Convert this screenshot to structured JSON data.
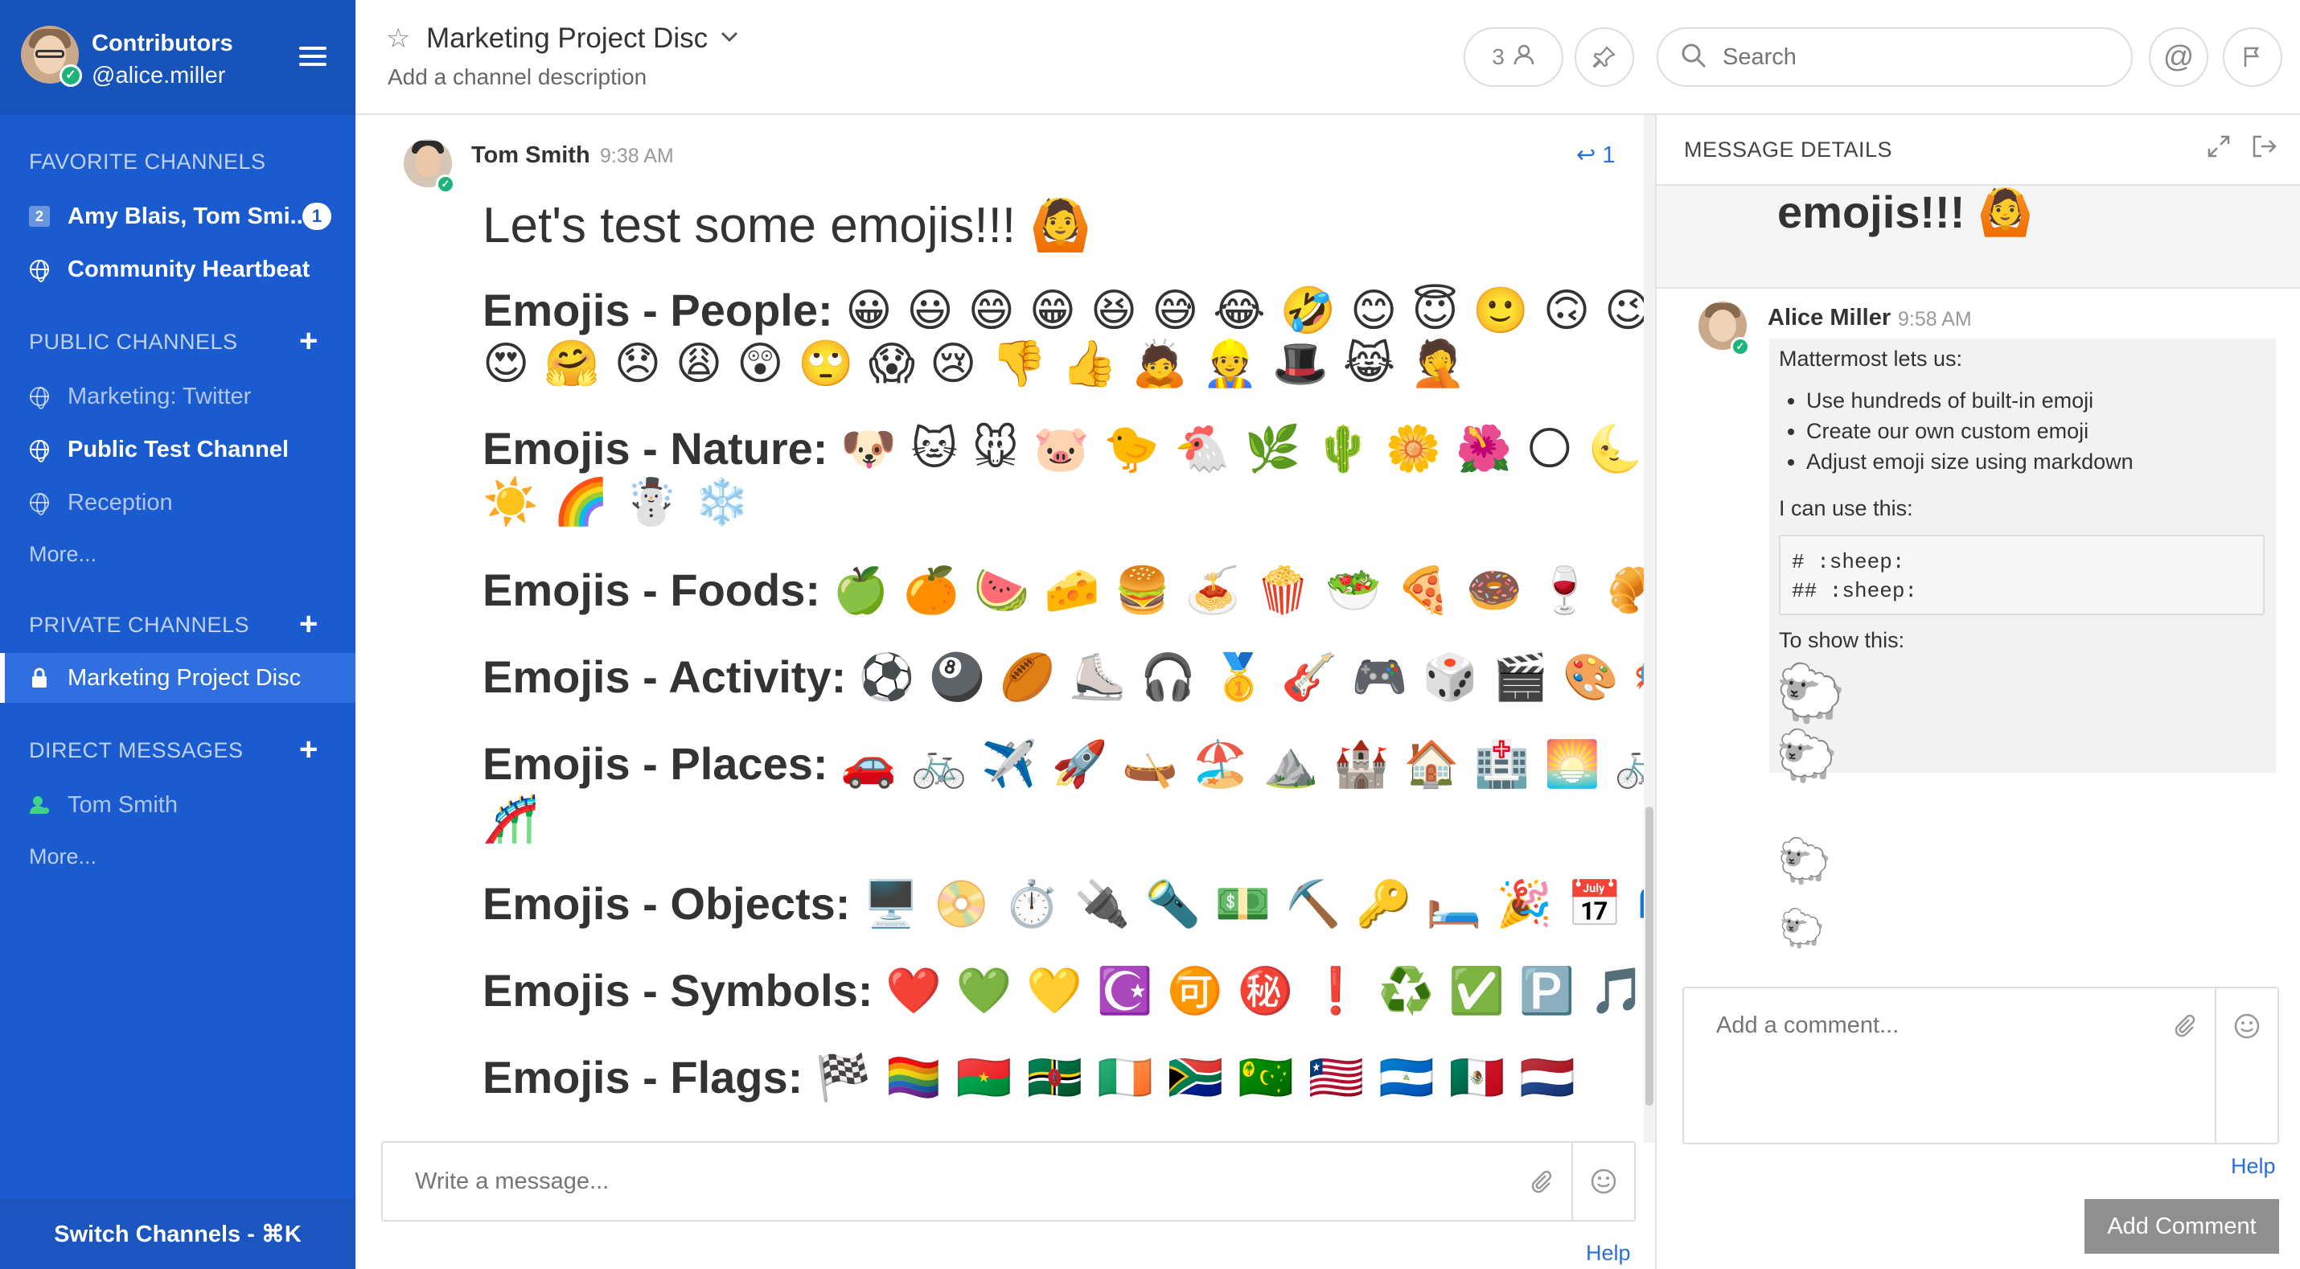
{
  "sidebar": {
    "team_name": "Contributors",
    "username": "@alice.miller",
    "sections": {
      "favorites": "FAVORITE CHANNELS",
      "public": "PUBLIC CHANNELS",
      "private": "PRIVATE CHANNELS",
      "direct": "DIRECT MESSAGES"
    },
    "favorites": [
      {
        "label": "Amy Blais, Tom Smi...",
        "icon": "2",
        "badge": "1"
      },
      {
        "label": "Community Heartbeat",
        "icon": "globe-icon"
      }
    ],
    "public": [
      {
        "label": "Marketing: Twitter",
        "icon": "globe-icon"
      },
      {
        "label": "Public Test Channel",
        "icon": "globe-icon"
      },
      {
        "label": "Reception",
        "icon": "globe-icon"
      }
    ],
    "public_more": "More...",
    "private": [
      {
        "label": "Marketing Project Disc",
        "icon": "lock-icon"
      }
    ],
    "direct": [
      {
        "label": "Tom Smith",
        "icon": "user-online-icon"
      }
    ],
    "direct_more": "More...",
    "switch_channels": "Switch Channels - ⌘K",
    "colors": {
      "background": "#1a5bcf",
      "header": "#1653bb",
      "active": "#2f6fe0"
    }
  },
  "header": {
    "channel_name": "Marketing Project Disc",
    "channel_description": "Add a channel description",
    "member_count": "3",
    "search_placeholder": "Search"
  },
  "post": {
    "author": "Tom Smith",
    "time": "9:38 AM",
    "reply_count": "1",
    "title": "Let's test some emojis!!!",
    "title_emoji": "🙆",
    "lines": [
      {
        "label": "Emojis - People:",
        "emojis": "😀 😃 😄 😁 😆 😅 😂 🤣 😊 😇 🙂 🙃 😉"
      },
      {
        "label": "",
        "emojis": "😍 🤗 😞 😩 😲 🙄 😱 😢 👎 👍 🙇 👷 🎩 😹 🤦"
      },
      {
        "label": "Emojis - Nature:",
        "emojis": "🐶 🐱 🐭 🐷 🐤 🐔 🌿 🌵 🌼 🌺 🌕 🌜 ⭐"
      },
      {
        "label": "",
        "emojis": "☀️ 🌈 ☃️ ❄️"
      },
      {
        "label": "Emojis - Foods:",
        "emojis": "🍏 🍊 🍉 🧀 🍔 🍝 🍿 🥗 🍕 🍩 🍷 🥐"
      },
      {
        "label": "Emojis - Activity:",
        "emojis": "⚽ 🎱 🏉 ⛸️ 🎧 🥇 🎸 🎮 🎲 🎬 🎨 🎭 🎪"
      },
      {
        "label": "Emojis - Places:",
        "emojis": "🚗 🚲 ✈️ 🚀 🛶 🏖️ ⛰️ 🏰 🏠 🏥 🌅 🚲 🗽"
      },
      {
        "label": "",
        "emojis": "🎢"
      },
      {
        "label": "Emojis - Objects:",
        "emojis": "🖥️ 📀 ⏱️ 🔌 🔦 💵 ⛏️ 🔑 🛏️ 🎉 📅 📫 📒"
      },
      {
        "label": "Emojis - Symbols:",
        "emojis": "❤️ 💚 💛 ☪️ 🉑 ㊙️ ❗ ♻️ ✅ 🅿️ 🎵 🕐"
      },
      {
        "label": "Emojis - Flags:",
        "emojis": "🏁 🏳️‍🌈 🇧🇫 🇩🇲 🇮🇪 🇿🇦 🇨🇨 🇱🇷 🇳🇮 🇲🇽 🇳🇱"
      }
    ]
  },
  "composer": {
    "placeholder": "Write a message...",
    "help": "Help"
  },
  "rhs": {
    "title": "MESSAGE DETAILS",
    "root_preview": "emojis!!!",
    "root_emoji": "🙆",
    "reply": {
      "author": "Alice Miller",
      "time": "9:58 AM",
      "intro": "Mattermost lets us:",
      "bullets": [
        "Use hundreds of built-in emoji",
        "Create our own custom emoji",
        "Adjust emoji size using markdown"
      ],
      "use_label": "I can use this:",
      "code_lines": [
        "# :sheep:",
        "## :sheep:"
      ],
      "show_label": "To show this:",
      "sheep": [
        "🐑",
        "🐑",
        "🐑",
        "🐑"
      ]
    },
    "comment_placeholder": "Add a comment...",
    "help": "Help",
    "add_comment": "Add Comment"
  }
}
